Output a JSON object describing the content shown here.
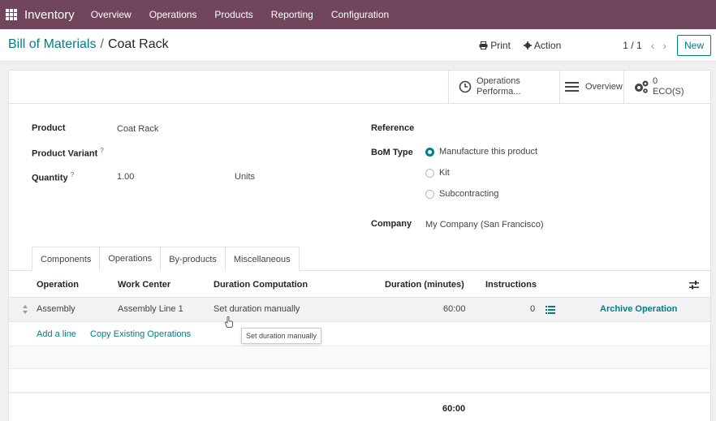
{
  "navbar": {
    "app_name": "Inventory",
    "menu": [
      "Overview",
      "Operations",
      "Products",
      "Reporting",
      "Configuration"
    ]
  },
  "breadcrumb": {
    "parent": "Bill of Materials",
    "separator": "/",
    "current": "Coat Rack"
  },
  "toolbar": {
    "print_label": "Print",
    "action_label": "Action",
    "pager": "1 / 1",
    "new_label": "New"
  },
  "smart_buttons": {
    "operations_performance": {
      "line1": "Operations",
      "line2": "Performa..."
    },
    "overview": {
      "label": "Overview"
    },
    "eco": {
      "count": "0",
      "label": "ECO(S)"
    }
  },
  "form": {
    "product_label": "Product",
    "product_value": "Coat Rack",
    "variant_label": "Product Variant",
    "help_mark": "?",
    "quantity_label": "Quantity",
    "quantity_value": "1.00",
    "uom_value": "Units",
    "reference_label": "Reference",
    "bom_type_label": "BoM Type",
    "bom_type_options": [
      "Manufacture this product",
      "Kit",
      "Subcontracting"
    ],
    "bom_type_selected": "Manufacture this product",
    "company_label": "Company",
    "company_value": "My Company (San Francisco)"
  },
  "tabs": [
    "Components",
    "Operations",
    "By-products",
    "Miscellaneous"
  ],
  "active_tab": "Operations",
  "operations_table": {
    "headers": {
      "operation": "Operation",
      "work_center": "Work Center",
      "duration_computation": "Duration Computation",
      "duration": "Duration (minutes)",
      "instructions": "Instructions"
    },
    "rows": [
      {
        "operation": "Assembly",
        "work_center": "Assembly Line 1",
        "duration_computation": "Set duration manually",
        "duration": "60:00",
        "instructions": "0",
        "archive": "Archive Operation"
      }
    ],
    "add_line": "Add a line",
    "copy_existing": "Copy Existing Operations",
    "total_duration": "60:00"
  },
  "tooltip": "Set duration manually",
  "colors": {
    "navbar": "#71465c",
    "accent": "#017e84"
  }
}
